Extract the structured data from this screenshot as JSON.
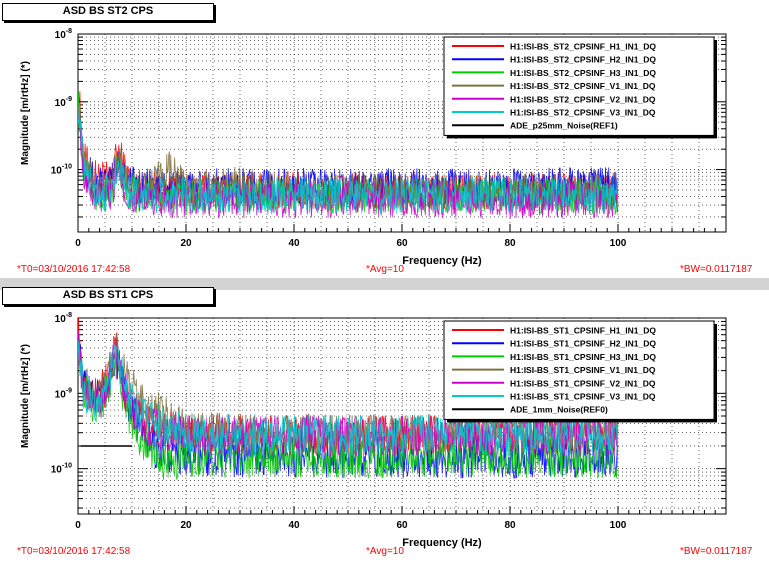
{
  "panels": [
    {
      "title": "ASD BS ST2 CPS",
      "footer": {
        "t0": "*T0=03/10/2016 17:42:58",
        "avg": "*Avg=10",
        "bw": "*BW=0.0117187"
      },
      "chart_data": {
        "type": "line",
        "xlabel": "Frequency (Hz)",
        "ylabel": "Magnitude [m/rtHz] (*)",
        "x_ticks": [
          "0",
          "20",
          "40",
          "60",
          "80",
          "100"
        ],
        "y_ticks": [
          "10^-8",
          "10^-9",
          "10^-10"
        ],
        "xlim": [
          0,
          120
        ],
        "ylim": [
          1.2e-11,
          1e-08
        ],
        "log_y": true,
        "grid": true,
        "legend_position": "top-right",
        "series": [
          {
            "name": "H1:ISI-BS_ST2_CPSINF_H1_IN1_DQ",
            "color": "#ff0000",
            "points": [
              [
                0,
                2e-09
              ],
              [
                1,
                1.5e-10
              ],
              [
                3,
                8e-11
              ],
              [
                6,
                7e-11
              ],
              [
                7.5,
                1.9e-10
              ],
              [
                9,
                8e-11
              ],
              [
                12,
                5.2e-11
              ],
              [
                20,
                5e-11
              ],
              [
                40,
                5e-11
              ],
              [
                60,
                4.8e-11
              ],
              [
                80,
                4.8e-11
              ],
              [
                100,
                4.8e-11
              ]
            ]
          },
          {
            "name": "H1:ISI-BS_ST2_CPSINF_H2_IN1_DQ",
            "color": "#0000ff",
            "points": [
              [
                0,
                1.5e-09
              ],
              [
                1,
                1.2e-10
              ],
              [
                3,
                7e-11
              ],
              [
                6,
                6e-11
              ],
              [
                7.5,
                1.6e-10
              ],
              [
                9,
                7e-11
              ],
              [
                12,
                5.5e-11
              ],
              [
                20,
                5.6e-11
              ],
              [
                40,
                5.6e-11
              ],
              [
                60,
                5.6e-11
              ],
              [
                80,
                5.6e-11
              ],
              [
                100,
                5.8e-11
              ]
            ]
          },
          {
            "name": "H1:ISI-BS_ST2_CPSINF_H3_IN1_DQ",
            "color": "#00cc00",
            "points": [
              [
                0,
                1.2e-09
              ],
              [
                1,
                1.1e-10
              ],
              [
                3,
                4.5e-11
              ],
              [
                6,
                4e-11
              ],
              [
                7.5,
                1.3e-10
              ],
              [
                9,
                5e-11
              ],
              [
                12,
                4e-11
              ],
              [
                20,
                4e-11
              ],
              [
                40,
                4e-11
              ],
              [
                60,
                4e-11
              ],
              [
                80,
                4e-11
              ],
              [
                100,
                4e-11
              ]
            ]
          },
          {
            "name": "H1:ISI-BS_ST2_CPSINF_V1_IN1_DQ",
            "color": "#807040",
            "points": [
              [
                0,
                1e-09
              ],
              [
                1,
                1.3e-10
              ],
              [
                3,
                6e-11
              ],
              [
                6,
                5e-11
              ],
              [
                7.5,
                1.7e-10
              ],
              [
                9,
                6e-11
              ],
              [
                12,
                4.6e-11
              ],
              [
                17,
                1e-10
              ],
              [
                20,
                5e-11
              ],
              [
                30,
                6e-11
              ],
              [
                40,
                4.6e-11
              ],
              [
                60,
                4.6e-11
              ],
              [
                80,
                4.6e-11
              ],
              [
                100,
                4.6e-11
              ]
            ]
          },
          {
            "name": "H1:ISI-BS_ST2_CPSINF_V2_IN1_DQ",
            "color": "#cc00cc",
            "points": [
              [
                0,
                1e-09
              ],
              [
                1,
                1e-10
              ],
              [
                3,
                4e-11
              ],
              [
                6,
                3.5e-11
              ],
              [
                7.5,
                1.2e-10
              ],
              [
                9,
                4e-11
              ],
              [
                12,
                3.6e-11
              ],
              [
                20,
                3.6e-11
              ],
              [
                40,
                3.6e-11
              ],
              [
                60,
                3.6e-11
              ],
              [
                80,
                3.6e-11
              ],
              [
                100,
                3.6e-11
              ]
            ]
          },
          {
            "name": "H1:ISI-BS_ST2_CPSINF_V3_IN1_DQ",
            "color": "#00cccc",
            "points": [
              [
                0,
                1e-09
              ],
              [
                1,
                1.1e-10
              ],
              [
                3,
                5e-11
              ],
              [
                6,
                4.5e-11
              ],
              [
                7.5,
                1.4e-10
              ],
              [
                9,
                5e-11
              ],
              [
                12,
                4.2e-11
              ],
              [
                20,
                4.2e-11
              ],
              [
                40,
                4.2e-11
              ],
              [
                60,
                4.2e-11
              ],
              [
                80,
                4.2e-11
              ],
              [
                100,
                4.2e-11
              ]
            ]
          },
          {
            "name": "ADE_p25mm_Noise(REF1)",
            "color": "#000000",
            "points": []
          }
        ]
      }
    },
    {
      "title": "ASD BS ST1 CPS",
      "footer": {
        "t0": "*T0=03/10/2016 17:42:58",
        "avg": "*Avg=10",
        "bw": "*BW=0.0117187"
      },
      "chart_data": {
        "type": "line",
        "xlabel": "Frequency (Hz)",
        "ylabel": "Magnitude [m/rtHz] (*)",
        "x_ticks": [
          "0",
          "20",
          "40",
          "60",
          "80",
          "100"
        ],
        "y_ticks": [
          "10^-8",
          "10^-9",
          "10^-10"
        ],
        "xlim": [
          0,
          120
        ],
        "ylim": [
          2.5e-11,
          1e-08
        ],
        "log_y": true,
        "grid": true,
        "legend_position": "top-right",
        "series": [
          {
            "name": "H1:ISI-BS_ST1_CPSINF_H1_IN1_DQ",
            "color": "#ff0000",
            "points": [
              [
                0,
                8e-09
              ],
              [
                1,
                1.5e-09
              ],
              [
                3,
                1e-09
              ],
              [
                5,
                1.2e-09
              ],
              [
                7,
                4e-09
              ],
              [
                9,
                9e-10
              ],
              [
                12,
                4e-10
              ],
              [
                16,
                3.2e-10
              ],
              [
                20,
                3e-10
              ],
              [
                40,
                2.8e-10
              ],
              [
                60,
                2.8e-10
              ],
              [
                80,
                2.8e-10
              ],
              [
                100,
                2.9e-10
              ]
            ]
          },
          {
            "name": "H1:ISI-BS_ST1_CPSINF_H2_IN1_DQ",
            "color": "#0000ff",
            "points": [
              [
                0,
                6e-09
              ],
              [
                1,
                1.2e-09
              ],
              [
                3,
                8e-10
              ],
              [
                5,
                1e-09
              ],
              [
                7,
                3.5e-09
              ],
              [
                9,
                8e-10
              ],
              [
                12,
                3e-10
              ],
              [
                15,
                1.6e-10
              ],
              [
                20,
                1.5e-10
              ],
              [
                40,
                1.4e-10
              ],
              [
                60,
                1.4e-10
              ],
              [
                80,
                1.4e-10
              ],
              [
                100,
                1.4e-10
              ]
            ]
          },
          {
            "name": "H1:ISI-BS_ST1_CPSINF_H3_IN1_DQ",
            "color": "#00cc00",
            "points": [
              [
                0,
                5e-09
              ],
              [
                1,
                1.1e-09
              ],
              [
                3,
                7e-10
              ],
              [
                5,
                9e-10
              ],
              [
                7,
                3e-09
              ],
              [
                9,
                6e-10
              ],
              [
                12,
                2.2e-10
              ],
              [
                15,
                1.3e-10
              ],
              [
                20,
                1.4e-10
              ],
              [
                40,
                1.4e-10
              ],
              [
                60,
                1.4e-10
              ],
              [
                80,
                1.4e-10
              ],
              [
                100,
                1.4e-10
              ]
            ]
          },
          {
            "name": "H1:ISI-BS_ST1_CPSINF_V1_IN1_DQ",
            "color": "#807040",
            "points": [
              [
                0,
                5e-09
              ],
              [
                1,
                1.3e-09
              ],
              [
                3,
                9e-10
              ],
              [
                5,
                1.1e-09
              ],
              [
                7,
                3.8e-09
              ],
              [
                9,
                1.5e-09
              ],
              [
                12,
                8e-10
              ],
              [
                16,
                6e-10
              ],
              [
                20,
                3e-10
              ],
              [
                40,
                2.8e-10
              ],
              [
                60,
                2.8e-10
              ],
              [
                80,
                2.8e-10
              ],
              [
                100,
                2.8e-10
              ]
            ]
          },
          {
            "name": "H1:ISI-BS_ST1_CPSINF_V2_IN1_DQ",
            "color": "#cc00cc",
            "points": [
              [
                0,
                5e-09
              ],
              [
                1,
                1e-09
              ],
              [
                3,
                8e-10
              ],
              [
                5,
                1e-09
              ],
              [
                7,
                3.2e-09
              ],
              [
                9,
                9e-10
              ],
              [
                12,
                4e-10
              ],
              [
                16,
                3e-10
              ],
              [
                20,
                2.8e-10
              ],
              [
                40,
                2.7e-10
              ],
              [
                60,
                2.7e-10
              ],
              [
                80,
                2.7e-10
              ],
              [
                100,
                2.7e-10
              ]
            ]
          },
          {
            "name": "H1:ISI-BS_ST1_CPSINF_V3_IN1_DQ",
            "color": "#00cccc",
            "points": [
              [
                0,
                5e-09
              ],
              [
                1,
                1.1e-09
              ],
              [
                3,
                8e-10
              ],
              [
                5,
                1e-09
              ],
              [
                7,
                3.4e-09
              ],
              [
                9,
                1e-09
              ],
              [
                12,
                5e-10
              ],
              [
                16,
                3.5e-10
              ],
              [
                20,
                2.9e-10
              ],
              [
                40,
                2.8e-10
              ],
              [
                60,
                2.8e-10
              ],
              [
                80,
                2.8e-10
              ],
              [
                100,
                2.8e-10
              ]
            ]
          },
          {
            "name": "ADE_1mm_Noise(REF0)",
            "color": "#000000",
            "points": [
              [
                0.5,
                2e-10
              ],
              [
                1,
                2e-10
              ],
              [
                10,
                2e-10
              ]
            ]
          }
        ]
      }
    }
  ]
}
